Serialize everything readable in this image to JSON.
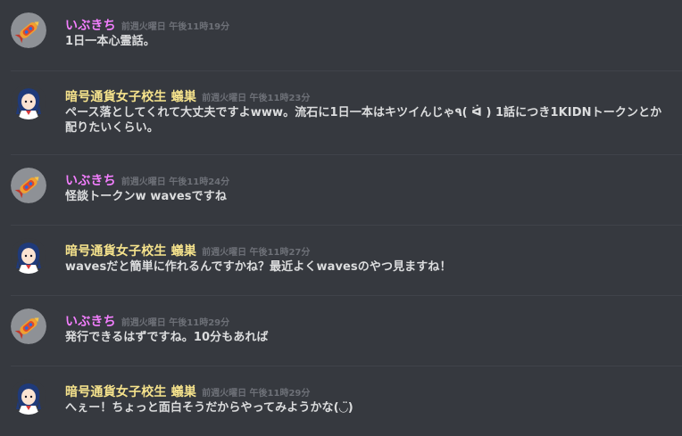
{
  "colors": {
    "background": "#36393f",
    "user_ibukichi": "#f47fff",
    "user_anki": "#f5e28c",
    "timestamp": "#6d7077",
    "message_text": "#dcddde"
  },
  "messages": [
    {
      "username": "いぶきち",
      "timestamp": "前週火曜日 午後11時19分",
      "text": "1日一本心霊話。",
      "avatar_icon": "rocket-avatar-icon"
    },
    {
      "username": "暗号通貨女子校生 蟻巣",
      "timestamp": "前週火曜日 午後11時23分",
      "text": "ペース落としてくれて大丈夫ですよwww。流石に1日一本はキツイんじゃ٩( ᐛ ) 1話につき1KIDNトークンとか配りたいくらい。",
      "avatar_icon": "anime-girl-avatar-icon"
    },
    {
      "username": "いぶきち",
      "timestamp": "前週火曜日 午後11時24分",
      "text": "怪談トークンw wavesですね",
      "avatar_icon": "rocket-avatar-icon"
    },
    {
      "username": "暗号通貨女子校生 蟻巣",
      "timestamp": "前週火曜日 午後11時27分",
      "text": "wavesだと簡単に作れるんですかね？最近よくwavesのやつ見ますね！",
      "avatar_icon": "anime-girl-avatar-icon"
    },
    {
      "username": "いぶきち",
      "timestamp": "前週火曜日 午後11時29分",
      "text": "発行できるはずですね。10分もあれば",
      "avatar_icon": "rocket-avatar-icon"
    },
    {
      "username": "暗号通貨女子校生 蟻巣",
      "timestamp": "前週火曜日 午後11時29分",
      "text": "へぇー！ちょっと面白そうだからやってみようかな(◡̈)",
      "avatar_icon": "anime-girl-avatar-icon"
    }
  ]
}
